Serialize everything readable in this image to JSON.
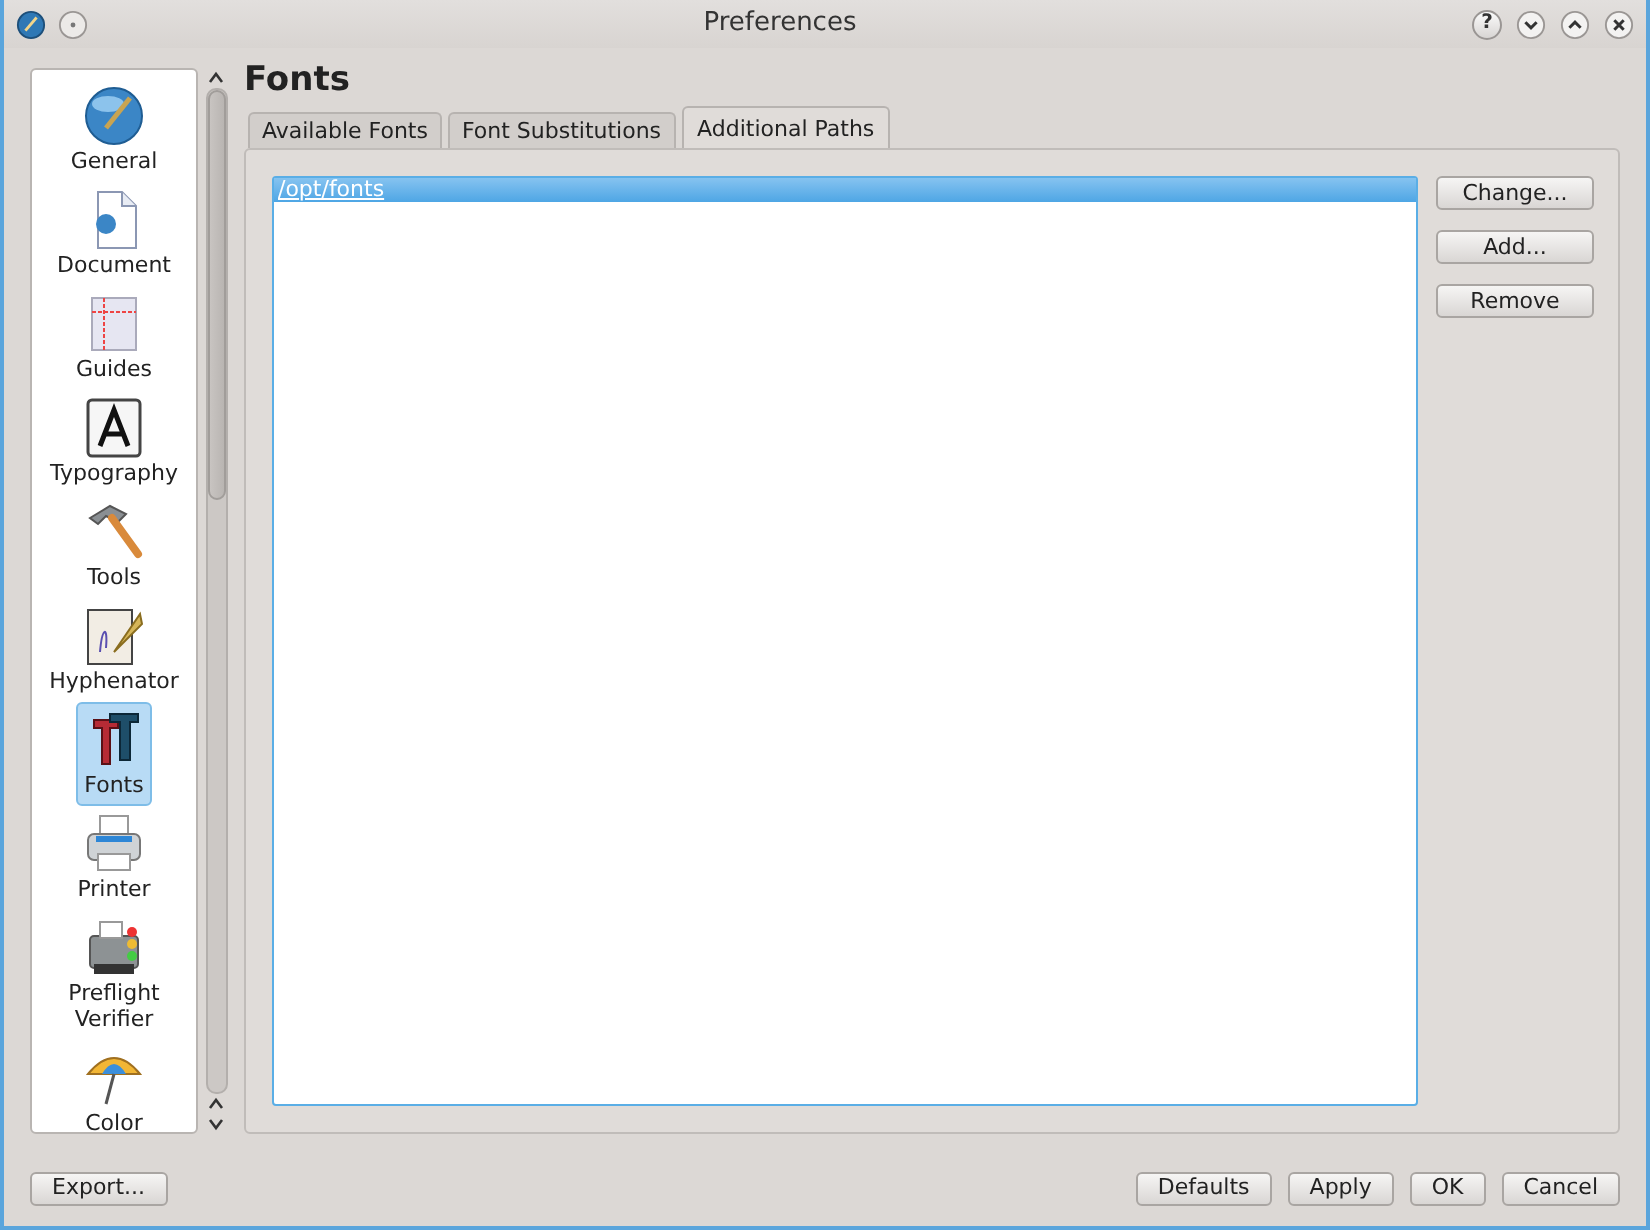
{
  "window": {
    "title": "Preferences",
    "help_button": "?"
  },
  "sidebar": {
    "items": [
      {
        "label": "General",
        "selected": false
      },
      {
        "label": "Document",
        "selected": false
      },
      {
        "label": "Guides",
        "selected": false
      },
      {
        "label": "Typography",
        "selected": false
      },
      {
        "label": "Tools",
        "selected": false
      },
      {
        "label": "Hyphenator",
        "selected": false
      },
      {
        "label": "Fonts",
        "selected": true
      },
      {
        "label": "Printer",
        "selected": false
      },
      {
        "label": "Preflight Verifier",
        "selected": false
      },
      {
        "label": "Color",
        "selected": false
      }
    ]
  },
  "page_title": "Fonts",
  "tabs": [
    {
      "label": "Available Fonts",
      "selected": false
    },
    {
      "label": "Font Substitutions",
      "selected": false
    },
    {
      "label": "Additional Paths",
      "selected": true
    }
  ],
  "paths": [
    {
      "path": "/opt/fonts",
      "selected": true
    }
  ],
  "path_buttons": [
    "Change...",
    "Add...",
    "Remove"
  ],
  "footer": {
    "left_buttons": [
      "Export..."
    ],
    "right_buttons": [
      "Defaults",
      "Apply",
      "OK",
      "Cancel"
    ]
  }
}
